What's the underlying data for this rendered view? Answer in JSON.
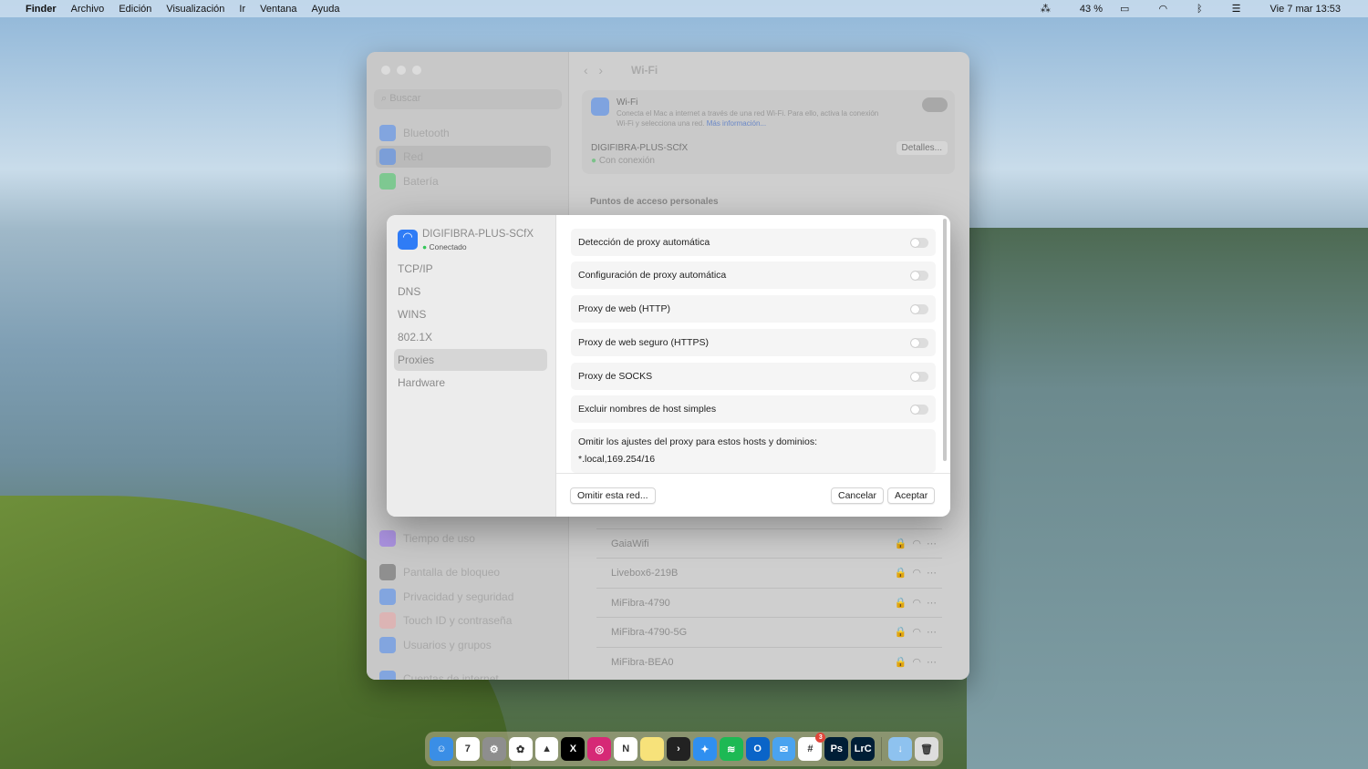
{
  "menubar": {
    "app": "Finder",
    "items": [
      "Archivo",
      "Edición",
      "Visualización",
      "Ir",
      "Ventana",
      "Ayuda"
    ],
    "battery": "43 %",
    "clock": "Vie 7 mar 13:53"
  },
  "settings": {
    "search_placeholder": "Buscar",
    "title": "Wi-Fi",
    "sidebar": [
      {
        "label": "Bluetooth",
        "color": "#3b82f6"
      },
      {
        "label": "Red",
        "color": "#3b82f6"
      },
      {
        "label": "Batería",
        "color": "#34c759"
      },
      {
        "label": "Tiempo de uso",
        "color": "#8b5cf6"
      },
      {
        "label": "Pantalla de bloqueo",
        "color": "#555555"
      },
      {
        "label": "Privacidad y seguridad",
        "color": "#3b82f6"
      },
      {
        "label": "Touch ID y contraseña",
        "color": "#f0a0a0"
      },
      {
        "label": "Usuarios y grupos",
        "color": "#3b82f6"
      },
      {
        "label": "Cuentas de internet",
        "color": "#3b82f6"
      }
    ],
    "wifi_label": "Wi-Fi",
    "wifi_desc": "Conecta el Mac a internet a través de una red Wi-Fi. Para ello, activa la conexión Wi-Fi y selecciona una red.",
    "wifi_link": "Más información...",
    "current_network": "DIGIFIBRA-PLUS-SCfX",
    "current_status": "Con conexión",
    "details_button": "Detalles...",
    "hotspots_heading": "Puntos de acceso personales",
    "networks": [
      "GaiaWifi",
      "Livebox6-219B",
      "MiFibra-4790",
      "MiFibra-4790-5G",
      "MiFibra-BEA0"
    ]
  },
  "dialog": {
    "network": "DIGIFIBRA-PLUS-SCfX",
    "status": "Conectado",
    "tabs": [
      "TCP/IP",
      "DNS",
      "WINS",
      "802.1X",
      "Proxies",
      "Hardware"
    ],
    "selected_tab": "Proxies",
    "options": [
      {
        "label": "Detección de proxy automática",
        "on": false
      },
      {
        "label": "Configuración de proxy automática",
        "on": false
      },
      {
        "label": "Proxy de web (HTTP)",
        "on": false
      },
      {
        "label": "Proxy de web seguro (HTTPS)",
        "on": false
      },
      {
        "label": "Proxy de SOCKS",
        "on": false
      },
      {
        "label": "Excluir nombres de host simples",
        "on": false
      }
    ],
    "bypass_label": "Omitir los ajustes del proxy para estos hosts y dominios:",
    "bypass_value": "*.local,169.254/16",
    "forget_button": "Omitir esta red...",
    "cancel_button": "Cancelar",
    "ok_button": "Aceptar"
  },
  "dock": [
    {
      "name": "finder",
      "label": "☺",
      "color": "#3a8ee6"
    },
    {
      "name": "calendar",
      "label": "7",
      "color": "#ffffff"
    },
    {
      "name": "system-settings",
      "label": "⚙",
      "color": "#8e8e8e"
    },
    {
      "name": "photos",
      "label": "✿",
      "color": "#ffffff"
    },
    {
      "name": "google-drive",
      "label": "▲",
      "color": "#ffffff"
    },
    {
      "name": "x",
      "label": "X",
      "color": "#000000"
    },
    {
      "name": "instagram",
      "label": "◎",
      "color": "#d62976"
    },
    {
      "name": "notion",
      "label": "N",
      "color": "#ffffff"
    },
    {
      "name": "notes",
      "label": "",
      "color": "#f7e27a"
    },
    {
      "name": "plex",
      "label": "›",
      "color": "#222222"
    },
    {
      "name": "safari",
      "label": "✦",
      "color": "#2f8ff0"
    },
    {
      "name": "spotify",
      "label": "≋",
      "color": "#1db954"
    },
    {
      "name": "outlook",
      "label": "O",
      "color": "#0a64c8"
    },
    {
      "name": "mail",
      "label": "✉",
      "color": "#4aa3f0"
    },
    {
      "name": "slack",
      "label": "#",
      "color": "#ffffff"
    },
    {
      "name": "photoshop",
      "label": "Ps",
      "color": "#001e36"
    },
    {
      "name": "lightroom-classic",
      "label": "LrC",
      "color": "#001e36"
    },
    {
      "name": "downloads",
      "label": "↓",
      "color": "#8ec2ef"
    },
    {
      "name": "trash",
      "label": "🗑",
      "color": "#dddddd"
    }
  ],
  "slack_badge": "3"
}
